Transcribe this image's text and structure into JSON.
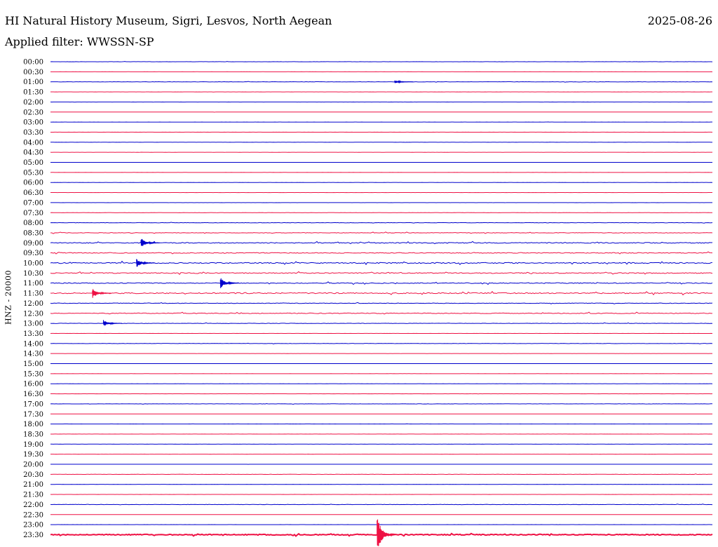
{
  "header": {
    "station": "HI Natural History Museum, Sigri, Lesvos, North Aegean",
    "date": "2025-08-26",
    "filter": "Applied filter: WWSSN-SP"
  },
  "channel_label": "HNZ - 20000",
  "colors": {
    "even": "#0000cc",
    "odd": "#ee1144"
  },
  "chart_data": {
    "type": "line",
    "title": "HI Natural History Museum, Sigri, Lesvos, North Aegean",
    "ylabel": "HNZ - 20000",
    "xlabel": "",
    "row_labels": [
      "00:00",
      "00:30",
      "01:00",
      "01:30",
      "02:00",
      "02:30",
      "03:00",
      "03:30",
      "04:00",
      "04:30",
      "05:00",
      "05:30",
      "06:00",
      "06:30",
      "07:00",
      "07:30",
      "08:00",
      "08:30",
      "09:00",
      "09:30",
      "10:00",
      "10:30",
      "11:00",
      "11:30",
      "12:00",
      "12:30",
      "13:00",
      "13:30",
      "14:00",
      "14:30",
      "15:00",
      "15:30",
      "16:00",
      "16:30",
      "17:00",
      "17:30",
      "18:00",
      "18:30",
      "19:00",
      "19:30",
      "20:00",
      "20:30",
      "21:00",
      "21:30",
      "22:00",
      "22:30",
      "23:00",
      "23:30"
    ],
    "row_minutes": 30,
    "noise_level": [
      0.2,
      0.1,
      0.3,
      0.1,
      0.1,
      0.1,
      0.1,
      0.1,
      0.1,
      0.1,
      0.1,
      0.1,
      0.1,
      0.1,
      0.1,
      0.2,
      0.4,
      0.6,
      1.0,
      0.9,
      1.2,
      1.0,
      0.9,
      1.2,
      0.6,
      0.8,
      0.4,
      0.1,
      0.3,
      0.1,
      0.1,
      0.1,
      0.1,
      0.1,
      0.3,
      0.1,
      0.1,
      0.1,
      0.1,
      0.1,
      0.1,
      0.3,
      0.1,
      0.1,
      0.4,
      0.1,
      0.1,
      1.0
    ],
    "events": [
      {
        "row": "01:00",
        "minute": 15.6,
        "amplitude": 2
      },
      {
        "row": "09:00",
        "minute": 4.1,
        "amplitude": 6
      },
      {
        "row": "10:00",
        "minute": 3.9,
        "amplitude": 5
      },
      {
        "row": "11:00",
        "minute": 7.7,
        "amplitude": 7
      },
      {
        "row": "11:30",
        "minute": 1.9,
        "amplitude": 6
      },
      {
        "row": "13:00",
        "minute": 2.4,
        "amplitude": 4
      },
      {
        "row": "23:30",
        "minute": 14.8,
        "amplitude": 22
      }
    ]
  }
}
